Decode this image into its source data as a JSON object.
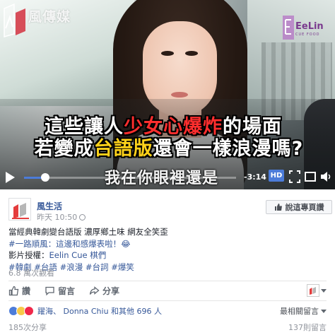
{
  "video": {
    "brand_text": "風傳媒",
    "eelin_name": "EeLin",
    "eelin_sub": "CUE FOOD",
    "subtitle_line1": {
      "pre": "這些讓人",
      "highlight": "少女心爆炸",
      "post": "的場面"
    },
    "subtitle_line2": {
      "pre": "若變成",
      "highlight": "台語版",
      "post": "還會一樣浪漫嗎?"
    },
    "lyric": "我在你眼裡還是",
    "time": "-3:14",
    "hd_label": "HD",
    "progress": 0.1
  },
  "post": {
    "page_name": "風生活",
    "time": "昨天 10:50",
    "follow_label": "說這專頁讚",
    "text_line1": "當經典韓劇變台語版 濃厚鄉土味 網友全笑歪",
    "text_line2": "#一路順風：這邊和感爆表啦！😂",
    "text_line3_label": "影片授權：",
    "text_line3_link": "Eelin Cue 棋們",
    "hashtags": [
      "#韓劇",
      "#台語",
      "#浪漫",
      "#台詞",
      "#爆笑"
    ],
    "views": "6.8 萬次觀看",
    "actions": {
      "like": "讚",
      "comment": "留言",
      "share": "分享"
    },
    "reactions_text": "躍海、 Donna Chiu 和其他 696 人",
    "top_comments": "最相關留言",
    "shares": "185次分享",
    "comments_count": "137則留言"
  },
  "colors": {
    "link": "#365899",
    "progress": "#4c7cd9",
    "subtitle_red": "#ff2e2e",
    "subtitle_yellow": "#ffd21a"
  }
}
